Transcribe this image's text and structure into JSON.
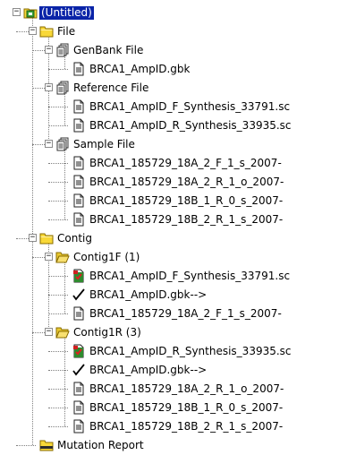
{
  "tree": {
    "nodes": [
      {
        "label": "(Untitled)",
        "level": 0,
        "icon": "project-root-icon",
        "expander": "minus",
        "selected": true
      },
      {
        "label": "File",
        "level": 1,
        "icon": "folder-icon",
        "expander": "minus"
      },
      {
        "label": "GenBank File",
        "level": 2,
        "icon": "file-group-icon",
        "expander": "minus"
      },
      {
        "label": "BRCA1_AmpID.gbk",
        "level": 3,
        "icon": "document-icon"
      },
      {
        "label": "Reference File",
        "level": 2,
        "icon": "file-group-icon",
        "expander": "minus"
      },
      {
        "label": "BRCA1_AmpID_F_Synthesis_33791.sc",
        "level": 3,
        "icon": "document-icon"
      },
      {
        "label": "BRCA1_AmpID_R_Synthesis_33935.sc",
        "level": 3,
        "icon": "document-icon"
      },
      {
        "label": "Sample File",
        "level": 2,
        "icon": "file-group-icon",
        "expander": "minus"
      },
      {
        "label": "BRCA1_185729_18A_2_F_1_s_2007-",
        "level": 3,
        "icon": "document-icon"
      },
      {
        "label": "BRCA1_185729_18A_2_R_1_o_2007-",
        "level": 3,
        "icon": "document-icon"
      },
      {
        "label": "BRCA1_185729_18B_1_R_0_s_2007-",
        "level": 3,
        "icon": "document-icon"
      },
      {
        "label": "BRCA1_185729_18B_2_R_1_s_2007-",
        "level": 3,
        "icon": "document-icon"
      },
      {
        "label": "Contig",
        "level": 1,
        "icon": "folder-icon",
        "expander": "minus"
      },
      {
        "label": "Contig1F  (1)",
        "level": 2,
        "icon": "open-folder-icon",
        "expander": "minus"
      },
      {
        "label": "BRCA1_AmpID_F_Synthesis_33791.sc",
        "level": 3,
        "icon": "reference-document-icon"
      },
      {
        "label": "BRCA1_AmpID.gbk-->",
        "level": 3,
        "icon": "checkmark-icon"
      },
      {
        "label": "BRCA1_185729_18A_2_F_1_s_2007-",
        "level": 3,
        "icon": "document-icon"
      },
      {
        "label": "Contig1R  (3)",
        "level": 2,
        "icon": "open-folder-icon",
        "expander": "minus"
      },
      {
        "label": "BRCA1_AmpID_R_Synthesis_33935.sc",
        "level": 3,
        "icon": "reference-document-icon"
      },
      {
        "label": "BRCA1_AmpID.gbk-->",
        "level": 3,
        "icon": "checkmark-icon"
      },
      {
        "label": "BRCA1_185729_18A_2_R_1_o_2007-",
        "level": 3,
        "icon": "document-icon"
      },
      {
        "label": "BRCA1_185729_18B_1_R_0_s_2007-",
        "level": 3,
        "icon": "document-icon"
      },
      {
        "label": "BRCA1_185729_18B_2_R_1_s_2007-",
        "level": 3,
        "icon": "document-icon"
      },
      {
        "label": "Mutation Report",
        "level": 1,
        "icon": "report-folder-icon"
      }
    ]
  },
  "colors": {
    "selection": "#0a24a8",
    "folder_yellow": "#f8d838",
    "connector": "#808080"
  }
}
